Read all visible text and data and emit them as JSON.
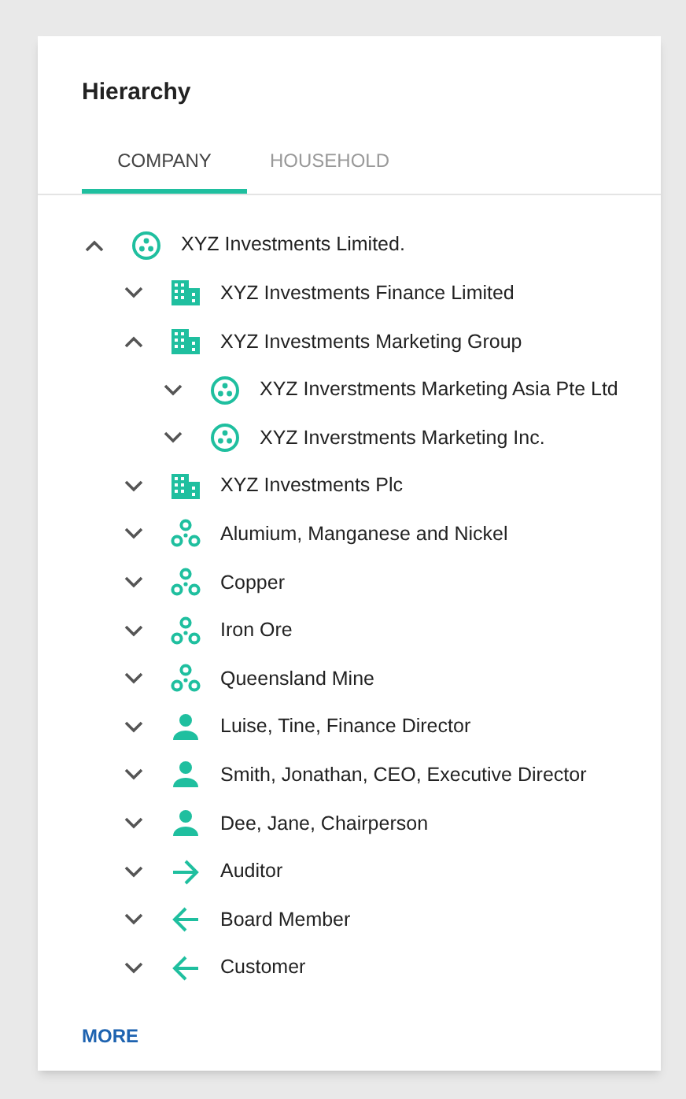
{
  "title": "Hierarchy",
  "tabs": [
    {
      "label": "COMPANY",
      "selected": true
    },
    {
      "label": "HOUSEHOLD",
      "selected": false
    }
  ],
  "tree": [
    {
      "kind": "company",
      "label": "XYZ Investments Limited.",
      "expanded": true,
      "children": [
        {
          "kind": "building",
          "label": "XYZ Investments Finance Limited",
          "expanded": false
        },
        {
          "kind": "building",
          "label": "XYZ Investments Marketing Group",
          "expanded": true,
          "children": [
            {
              "kind": "company",
              "label": "XYZ Inverstments Marketing Asia Pte Ltd",
              "expanded": false
            },
            {
              "kind": "company",
              "label": "XYZ Inverstments Marketing Inc.",
              "expanded": false
            }
          ]
        },
        {
          "kind": "building",
          "label": "XYZ Investments Plc",
          "expanded": false
        },
        {
          "kind": "group",
          "label": "Alumium, Manganese and Nickel",
          "expanded": false
        },
        {
          "kind": "group",
          "label": "Copper",
          "expanded": false
        },
        {
          "kind": "group",
          "label": "Iron Ore",
          "expanded": false
        },
        {
          "kind": "group",
          "label": "Queensland Mine",
          "expanded": false
        },
        {
          "kind": "person",
          "label": "Luise, Tine, Finance Director",
          "expanded": false
        },
        {
          "kind": "person",
          "label": "Smith, Jonathan, CEO, Executive Director",
          "expanded": false
        },
        {
          "kind": "person",
          "label": "Dee, Jane, Chairperson",
          "expanded": false
        },
        {
          "kind": "outgoing",
          "label": "Auditor",
          "expanded": false
        },
        {
          "kind": "incoming",
          "label": "Board Member",
          "expanded": false
        },
        {
          "kind": "incoming",
          "label": "Customer",
          "expanded": false
        }
      ]
    }
  ],
  "more_link": "MORE"
}
